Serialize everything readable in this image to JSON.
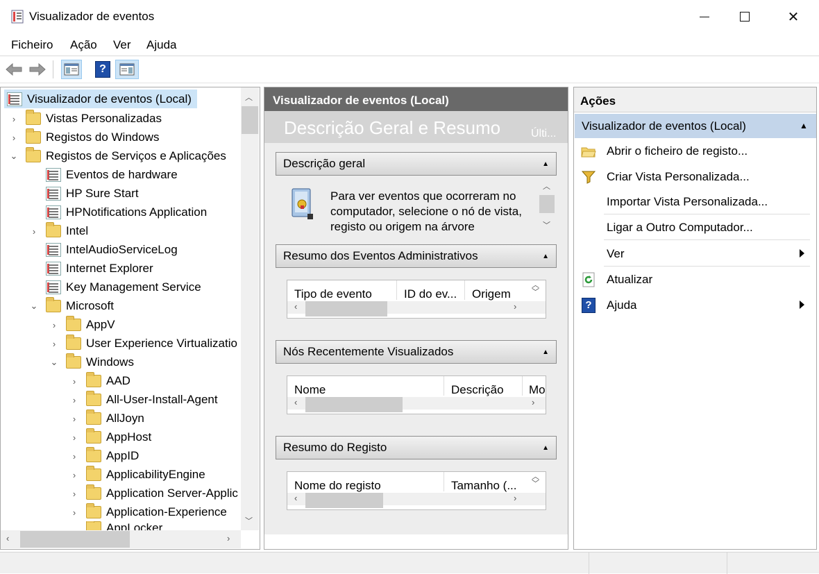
{
  "window": {
    "title": "Visualizador de eventos",
    "minimize": "—",
    "maximize": "☐",
    "close": "✕"
  },
  "menu": [
    "Ficheiro",
    "Ação",
    "Ver",
    "Ajuda"
  ],
  "tree": {
    "root": "Visualizador de eventos (Local)",
    "items": [
      "Vistas Personalizadas",
      "Registos do Windows",
      "Registos de Serviços e Aplicações",
      "Eventos de hardware",
      "HP Sure Start",
      "HPNotifications Application",
      "Intel",
      "IntelAudioServiceLog",
      "Internet Explorer",
      "Key Management Service",
      "Microsoft",
      "AppV",
      "User Experience Virtualizatio",
      "Windows",
      "AAD",
      "All-User-Install-Agent",
      "AllJoyn",
      "AppHost",
      "AppID",
      "ApplicabilityEngine",
      "Application Server-Applic",
      "Application-Experience",
      "AppLocker"
    ]
  },
  "center": {
    "header": "Visualizador de eventos (Local)",
    "banner": "Descrição Geral e Resumo",
    "banner_right": "Últi...",
    "overview": {
      "title": "Descrição geral",
      "text": "Para ver eventos que ocorreram no computador, selecione o nó de vista, registo ou origem na árvore"
    },
    "admin": {
      "title": "Resumo dos Eventos Administrativos",
      "cols": [
        "Tipo de evento",
        "ID do ev...",
        "Origem"
      ]
    },
    "recent": {
      "title": "Nós Recentemente Visualizados",
      "cols": [
        "Nome",
        "Descrição",
        "Mo"
      ]
    },
    "log": {
      "title": "Resumo do Registo",
      "cols": [
        "Nome do registo",
        "Tamanho (..."
      ]
    }
  },
  "actions": {
    "title": "Ações",
    "group": "Visualizador de eventos (Local)",
    "items": [
      "Abrir o ficheiro de registo...",
      "Criar Vista Personalizada...",
      "Importar Vista Personalizada...",
      "Ligar a Outro Computador...",
      "Ver",
      "Atualizar",
      "Ajuda"
    ]
  },
  "colors": {
    "header_dark": "#696969",
    "selected": "#cce4f7",
    "group_bg": "#c3d5ea"
  }
}
